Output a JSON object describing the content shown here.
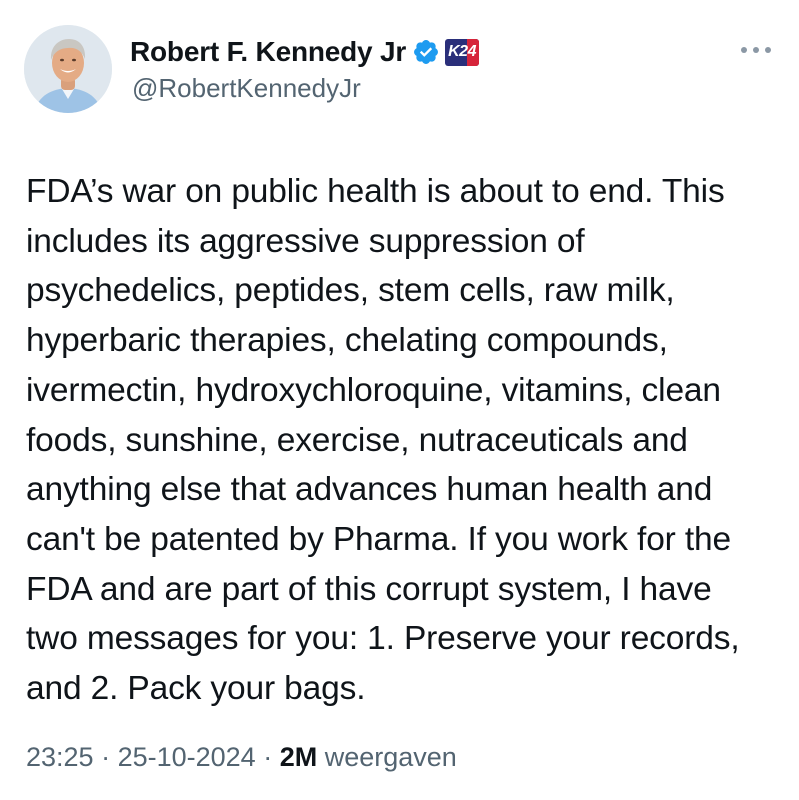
{
  "author": {
    "name": "Robert F. Kennedy Jr",
    "handle": "@RobertKennedyJr",
    "avatar_icon": "profile-photo",
    "verified": true,
    "affiliation_badge": "K24"
  },
  "tweet": {
    "text": "FDA’s war on public health is about to end. This\nincludes its aggressive suppression of\npsychedelics, peptides, stem cells, raw milk,\nhyperbaric therapies, chelating compounds,\nivermectin, hydroxychloroquine, vitamins, clean\nfoods, sunshine, exercise, nutraceuticals and\nanything else that advances human health and\ncan't be patented by Pharma. If you work for the\nFDA and are part of this corrupt system, I have\ntwo messages for you: 1. Preserve your records,\nand 2. Pack your bags."
  },
  "meta": {
    "time": "23:25",
    "separator": " · ",
    "date": "25-10-2024",
    "views_count": "2M",
    "views_label": "weergaven"
  },
  "colors": {
    "text_primary": "#0f1419",
    "text_secondary": "#536471",
    "verified_blue": "#1d9bf0",
    "badge_navy": "#2a2f7a",
    "badge_red": "#d6243a"
  },
  "icons": {
    "more": "more-horizontal-icon",
    "verified": "verified-badge-icon"
  }
}
